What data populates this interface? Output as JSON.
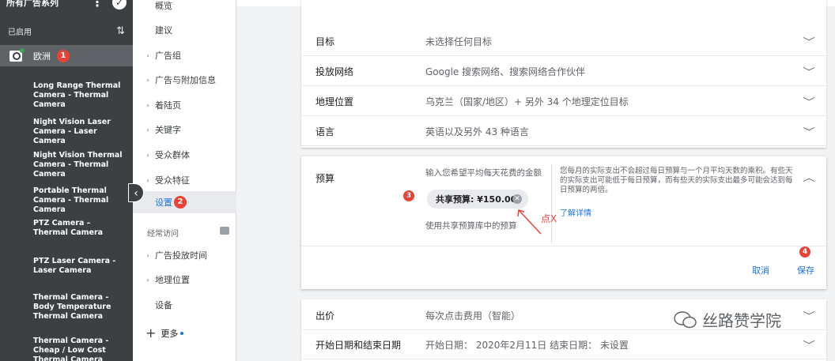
{
  "sidebar": {
    "title": "所有广告系列",
    "filter_label": "已启用",
    "selected_campaign": "欧洲",
    "selected_badge": "1",
    "campaigns": [
      "Long Range Thermal Camera - Thermal Camera",
      "Night Vision Laser Camera - Laser Camera",
      "Night Vision Thermal Camera - Thermal Camera",
      "Portable Thermal Camera - Thermal Camera",
      "PTZ Camera – Thermal Camera",
      "PTZ Laser Camera - Laser Camera",
      "Thermal Camera - Body Temperature Thermal Camera",
      "Thermal Camera - Cheap / Low Cost Thermal Camera"
    ]
  },
  "nav": {
    "items": [
      {
        "label": "概览",
        "arrow": false
      },
      {
        "label": "建议",
        "arrow": false
      },
      {
        "label": "广告组",
        "arrow": true
      },
      {
        "label": "广告与附加信息",
        "arrow": true
      },
      {
        "label": "着陆页",
        "arrow": true
      },
      {
        "label": "关键字",
        "arrow": true
      },
      {
        "label": "受众群体",
        "arrow": true
      },
      {
        "label": "受众特征",
        "arrow": true
      }
    ],
    "active": {
      "label": "设置",
      "badge": "2"
    },
    "section_label": "经常访问",
    "frequent": [
      {
        "label": "广告投放时间",
        "arrow": true
      },
      {
        "label": "地理位置",
        "arrow": true
      },
      {
        "label": "设备",
        "arrow": false
      }
    ],
    "more_label": "更多"
  },
  "settings": {
    "rows_top": [
      {
        "label": "目标",
        "value": "未选择任何目标"
      },
      {
        "label": "投放网络",
        "value": "Google 搜索网络、搜索网络合作伙伴"
      },
      {
        "label": "地理位置",
        "value": "乌克兰（国家/地区）+ 另外 34 个地理定位目标"
      },
      {
        "label": "语言",
        "value": "英语以及另外 43 种语言"
      }
    ],
    "budget": {
      "label": "预算",
      "prompt": "输入您希望平均每天花费的金额",
      "chip": "共享预算: ¥150.00",
      "shared_note": "使用共享预算库中的预算",
      "help_text": "您每月的实际支出不会超过每日预算与一个月平均天数的乘积。有些天的实际支出可能低于每日预算，而有些天的实际支出最多可能会达到每日预算的两倍。",
      "help_link": "了解详情",
      "cancel": "取消",
      "save": "保存"
    },
    "rows_bottom": [
      {
        "label": "出价",
        "value": "每次点击费用（智能）"
      },
      {
        "label": "开始日期和结束日期",
        "value": "开始日期： 2020年2月11日    结束日期： 未设置"
      }
    ]
  },
  "annotations": {
    "n3": "3",
    "n4": "4",
    "click_x": "点X"
  },
  "watermark": "丝路赞学院",
  "colors": {
    "accent": "#1a73e8",
    "marker": "#ea4335",
    "sidebar_bg": "#3c4043"
  }
}
